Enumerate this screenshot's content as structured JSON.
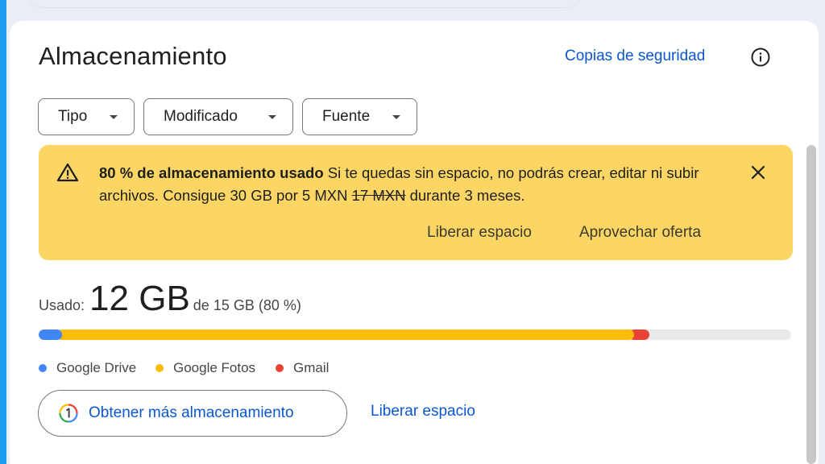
{
  "header": {
    "title": "Almacenamiento",
    "backup_link": "Copias de seguridad",
    "info_icon": "info-icon"
  },
  "filters": [
    {
      "label": "Tipo"
    },
    {
      "label": "Modificado"
    },
    {
      "label": "Fuente"
    }
  ],
  "banner": {
    "bold": "80 % de almacenamiento usado",
    "text_1": " Si te quedas sin espacio, no podrás crear, editar ni subir archivos. Consigue 30 GB por 5 MXN ",
    "old_price": "17 MXN",
    "text_2": " durante 3 meses.",
    "action_free": "Liberar espacio",
    "action_offer": "Aprovechar oferta",
    "color": "#fcd664",
    "icon": "warning-icon"
  },
  "usage": {
    "label": "Usado:",
    "used": "12 GB",
    "total": "de 15 GB (80 %)",
    "segments": [
      {
        "name": "Google Drive",
        "color": "#4285f4",
        "fraction": 0.025
      },
      {
        "name": "Google Fotos",
        "color": "#fbbc04",
        "fraction": 0.76
      },
      {
        "name": "Gmail",
        "color": "#ea4335",
        "fraction": 0.027
      }
    ]
  },
  "legend": [
    "Google Drive",
    "Google Fotos",
    "Gmail"
  ],
  "actions": {
    "get_more": "Obtener más almacenamiento",
    "free_space": "Liberar espacio"
  },
  "colors": {
    "accent": "#0b57d0",
    "drive": "#4285f4",
    "photos": "#fbbc04",
    "gmail": "#ea4335"
  }
}
